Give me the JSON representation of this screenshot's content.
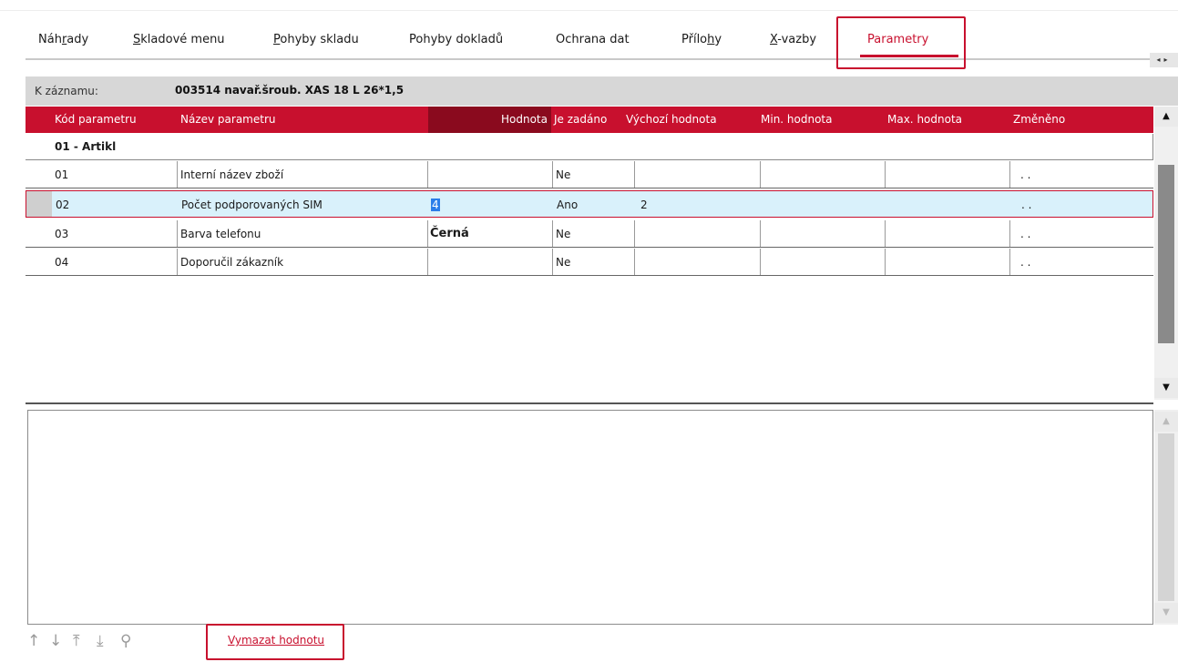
{
  "tabs": [
    {
      "pre": "Náh",
      "u": "r",
      "post": "ady"
    },
    {
      "pre": "",
      "u": "S",
      "post": "kladové menu"
    },
    {
      "pre": "",
      "u": "P",
      "post": "ohyby skladu"
    },
    {
      "pre": "Pohyby dokladů",
      "u": "",
      "post": ""
    },
    {
      "pre": "Ochrana dat",
      "u": "",
      "post": ""
    },
    {
      "pre": "Přílo",
      "u": "h",
      "post": "y"
    },
    {
      "pre": "",
      "u": "X",
      "post": "-vazby"
    },
    {
      "pre": "Parametry",
      "u": "",
      "post": ""
    }
  ],
  "active_tab": "Parametry",
  "record": {
    "label": "K záznamu:",
    "value": "003514 navař.šroub. XAS 18 L 26*1,5"
  },
  "columns": {
    "code": "Kód parametru",
    "name": "Název parametru",
    "value": "Hodnota",
    "entered": "Je zadáno",
    "default": "Výchozí hodnota",
    "min": "Min. hodnota",
    "max": "Max. hodnota",
    "changed": "Změněno"
  },
  "group": "01 - Artikl",
  "rows": [
    {
      "code": "01",
      "name": "Interní název zboží",
      "value": "",
      "entered": "Ne",
      "default": "",
      "min": "",
      "max": "",
      "changed": ". ."
    },
    {
      "code": "02",
      "name": "Počet podporovaných SIM",
      "value": "4",
      "entered": "Ano",
      "default": "2",
      "min": "",
      "max": "",
      "changed": ". ."
    },
    {
      "code": "03",
      "name": "Barva telefonu",
      "value": "Černá",
      "entered": "Ne",
      "default": "",
      "min": "",
      "max": "",
      "changed": ". ."
    },
    {
      "code": "04",
      "name": "Doporučil zákazník",
      "value": "",
      "entered": "Ne",
      "default": "",
      "min": "",
      "max": "",
      "changed": ". ."
    }
  ],
  "nav_icons": {
    "up": "↑",
    "down": "↓",
    "top": "⤒",
    "bottom": "⤓",
    "search": "⚲"
  },
  "scroll_arrows": {
    "up": "▲",
    "down": "▼",
    "tabs": "◂▸"
  },
  "actions": {
    "clear_value": "Vymazat hodnotu"
  },
  "colors": {
    "accent": "#c8102e",
    "selected_row": "#d9f1fb",
    "record_bar": "#d7d7d7"
  }
}
